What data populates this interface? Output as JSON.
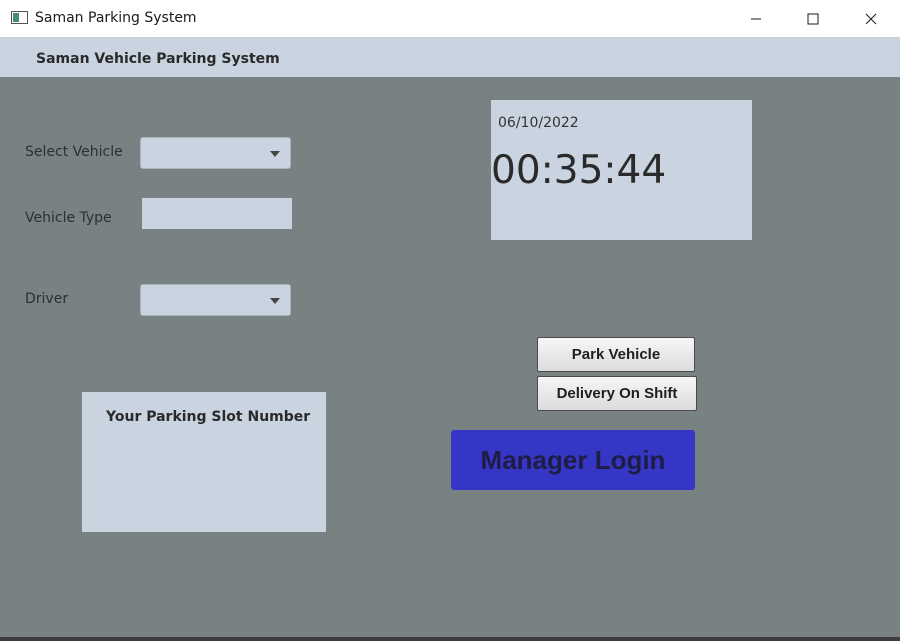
{
  "window": {
    "title": "Saman Parking System",
    "icon": "app-window-icon",
    "controls": [
      "minimize-icon",
      "maximize-icon",
      "close-icon"
    ]
  },
  "header": {
    "title": "Saman Vehicle Parking System"
  },
  "form": {
    "select_vehicle_label": "Select Vehicle",
    "select_vehicle_value": "",
    "vehicle_type_label": "Vehicle Type",
    "vehicle_type_value": "",
    "driver_label": "Driver",
    "driver_value": ""
  },
  "clock": {
    "date": "06/10/2022",
    "time": "00:35:44"
  },
  "actions": {
    "park_label": "Park Vehicle",
    "delivery_label": "Delivery On Shift",
    "manager_label": "Manager Login"
  },
  "slot": {
    "title": "Your Parking Slot Number",
    "value": ""
  },
  "colors": {
    "background": "#788283",
    "panel": "#c9d4e0",
    "manager_button": "#3636c6"
  }
}
